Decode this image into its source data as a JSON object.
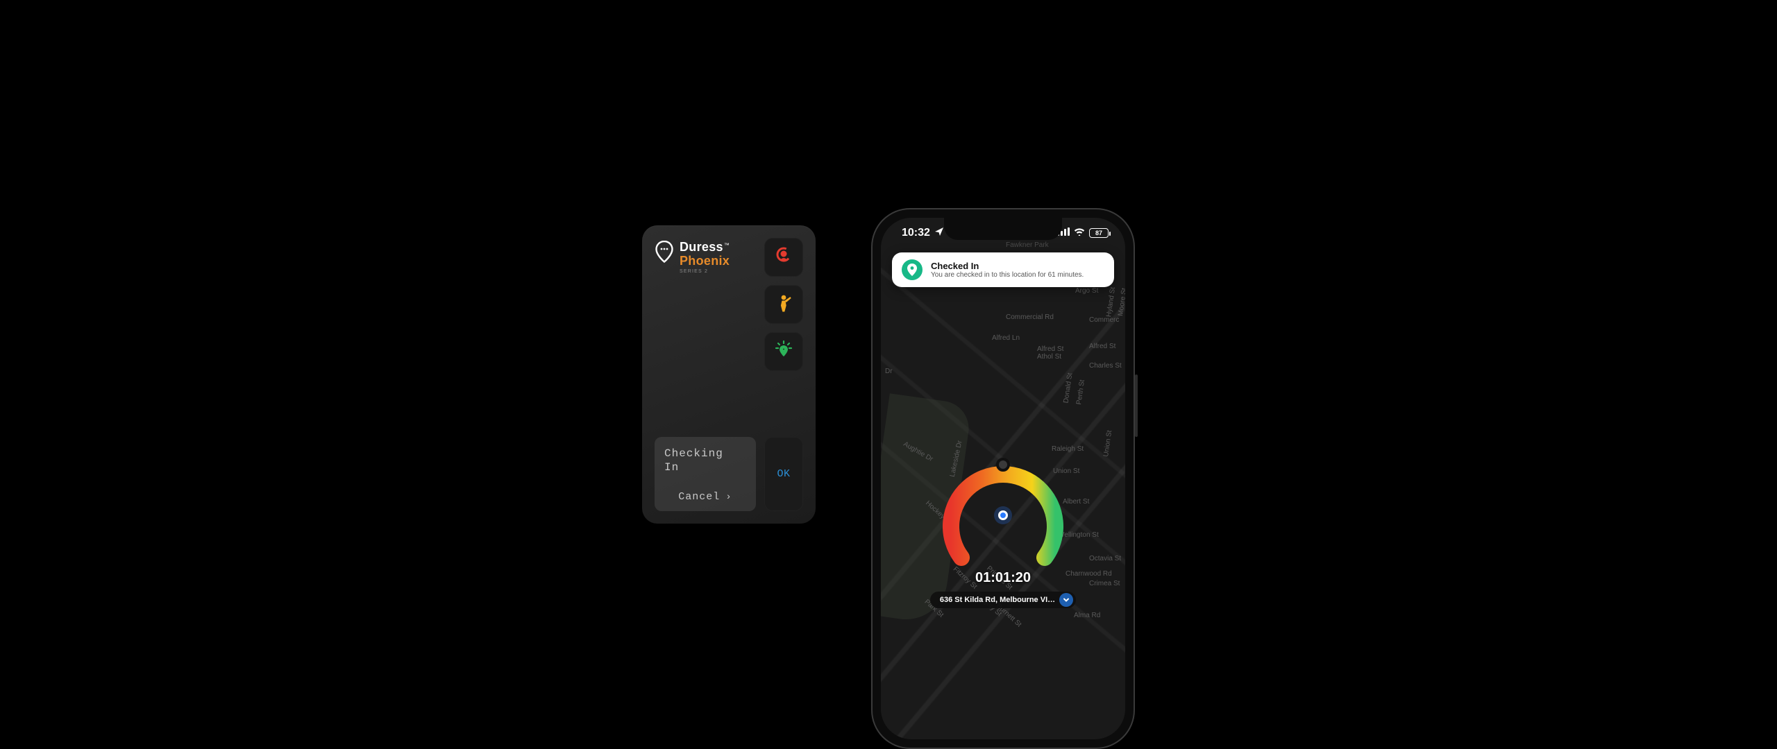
{
  "device": {
    "brand": {
      "line1": "Duress",
      "line2": "Phoenix",
      "series": "SERIES 2",
      "tm": "™"
    },
    "status": {
      "title": "Checking\nIn",
      "cancel": "Cancel"
    },
    "ok": "OK"
  },
  "phone": {
    "statusbar": {
      "time": "10:32",
      "battery": "87"
    },
    "banner": {
      "title": "Checked In",
      "subtitle": "You are checked in to this location for 61 minutes."
    },
    "timer": "01:01:20",
    "address": "636 St Kilda Rd, Melbourne VI…",
    "streets": {
      "commercial": "Commercial Rd",
      "commerc2": "Commerc",
      "argo": "Argo St",
      "hyland": "Hyland St",
      "moore": "Moore St",
      "alfred": "Alfred Ln",
      "alfredst1": "Alfred St",
      "alfredst2": "Alfred St",
      "athol": "Athol St",
      "charles": "Charles St",
      "donald": "Donald St",
      "perth": "Perth St",
      "raleigh": "Raleigh St",
      "union": "Union St",
      "albert": "Albert St",
      "wellington": "Wellington St",
      "octavia": "Octavia St",
      "charnwood": "Charnwood Rd",
      "crimea": "Crimea St",
      "alma": "Alma Rd",
      "fitzroy": "Fitzroy St",
      "princes": "Princes St",
      "dalgety": "Dalgety St",
      "burnett": "Burnett St",
      "park": "Park St",
      "hockey": "Hockey St",
      "lakeside": "Lakeside Dr",
      "aughtie": "Aughtie Dr",
      "dr": "Dr",
      "fawkner": "Fawkner Park"
    }
  }
}
